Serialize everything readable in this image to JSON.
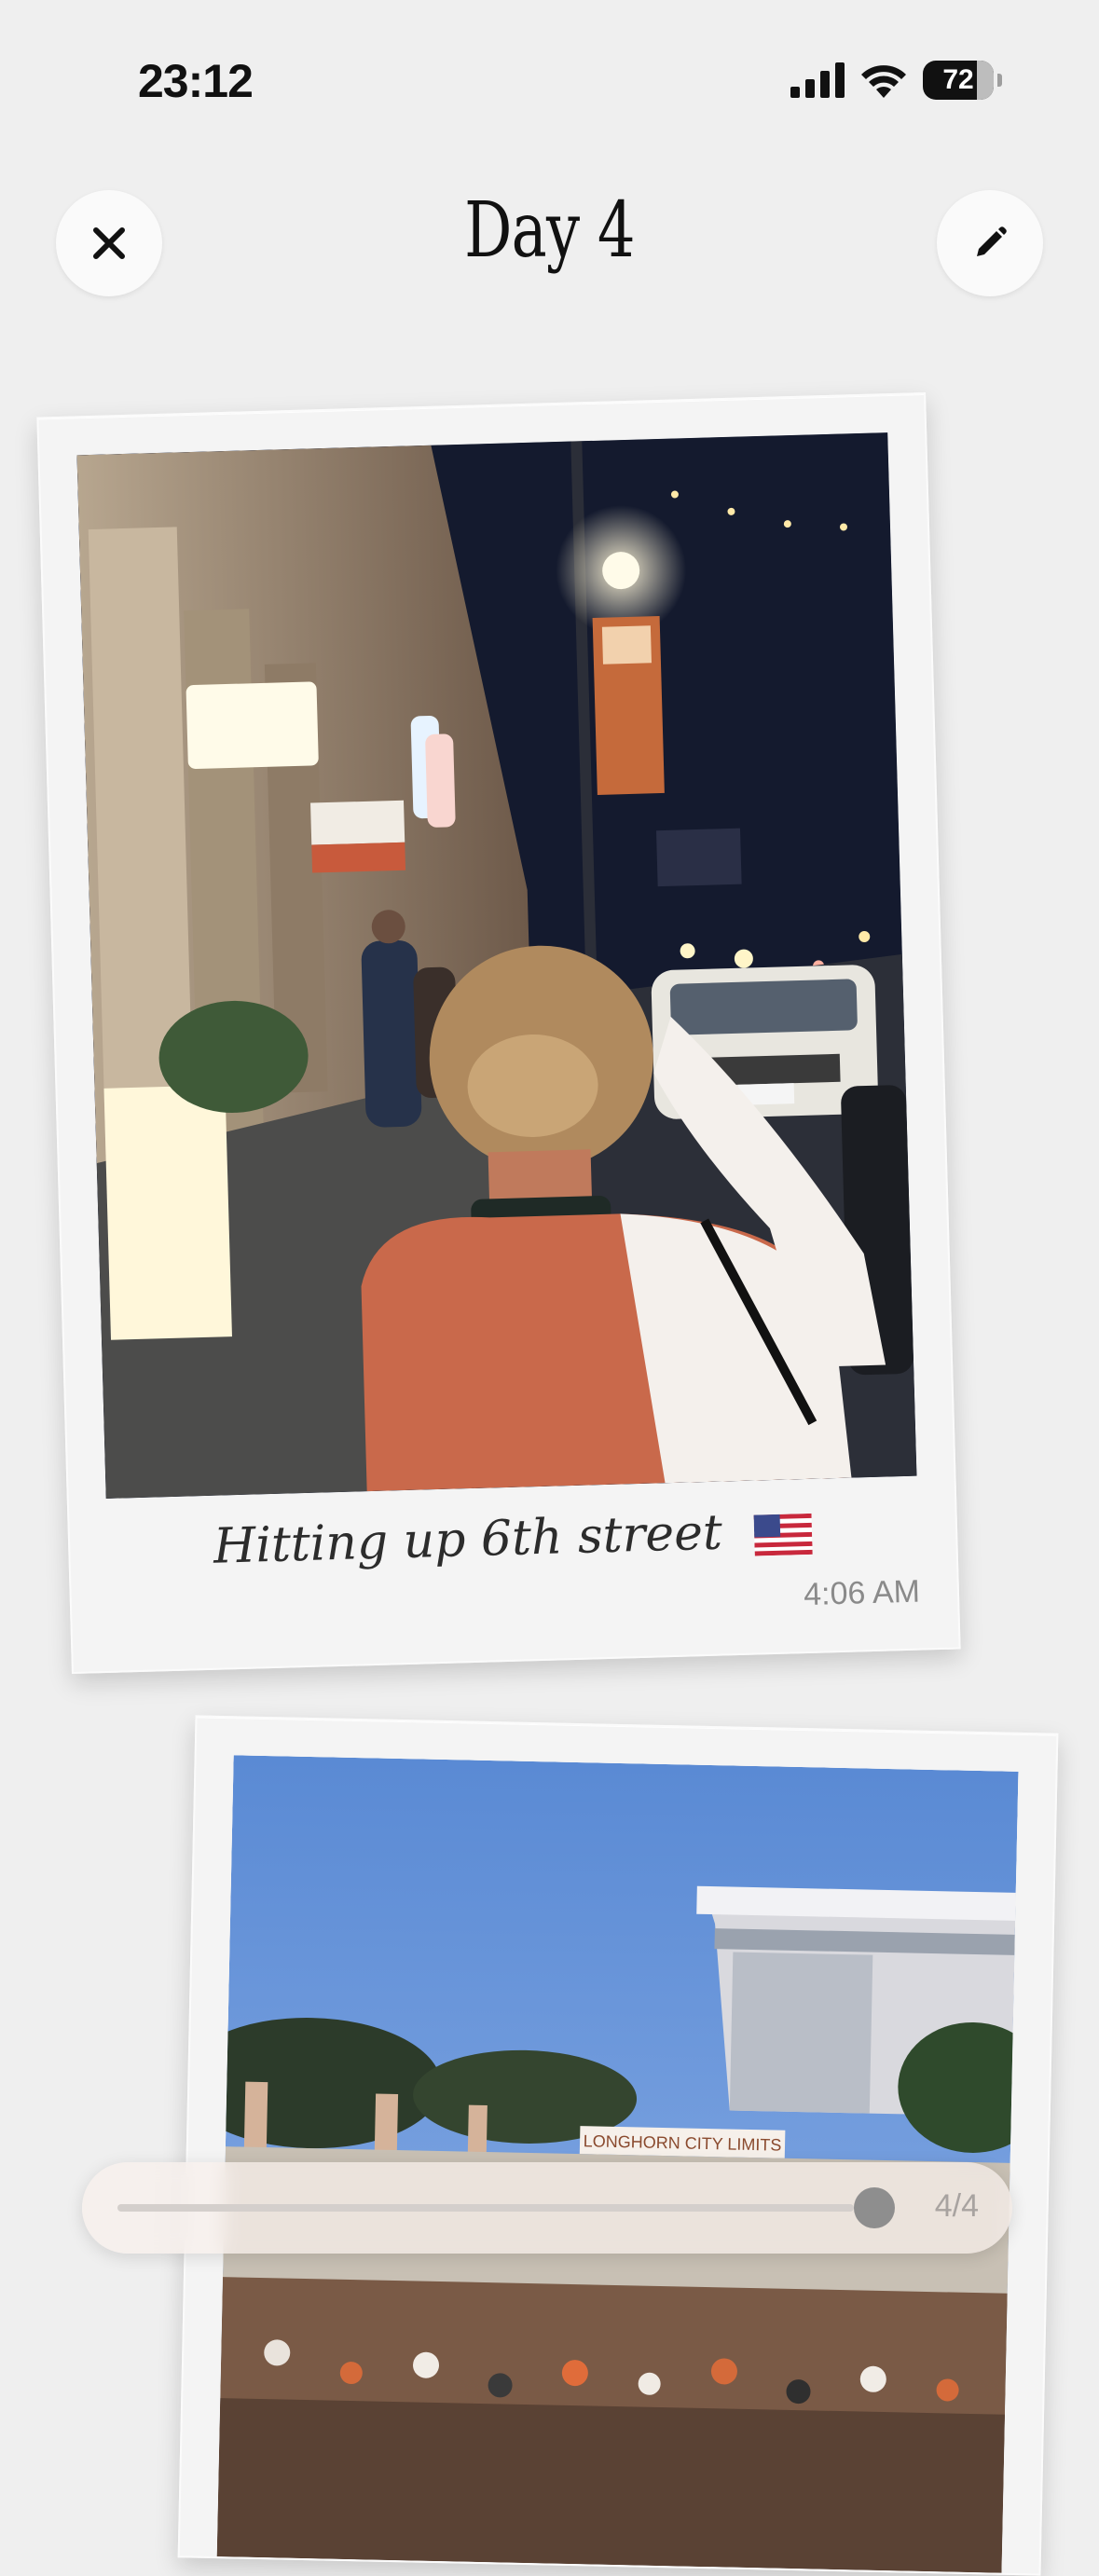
{
  "status_bar": {
    "time": "23:12",
    "battery": "72"
  },
  "header": {
    "title": "Day 4",
    "close_icon": "close-icon",
    "edit_icon": "pencil-icon"
  },
  "entries": [
    {
      "caption": "Hitting up 6th street",
      "emoji": "🇺🇸",
      "time": "4:06 AM",
      "photo": "night street scene"
    },
    {
      "photo": "Longhorn City Limits crowd",
      "sign_text": "LONGHORN CITY LIMITS"
    }
  ],
  "scrubber": {
    "counter": "4/4",
    "position": 1.0
  },
  "colors": {
    "background": "#efefef",
    "card": "#f4f4f4",
    "text": "#111111"
  }
}
